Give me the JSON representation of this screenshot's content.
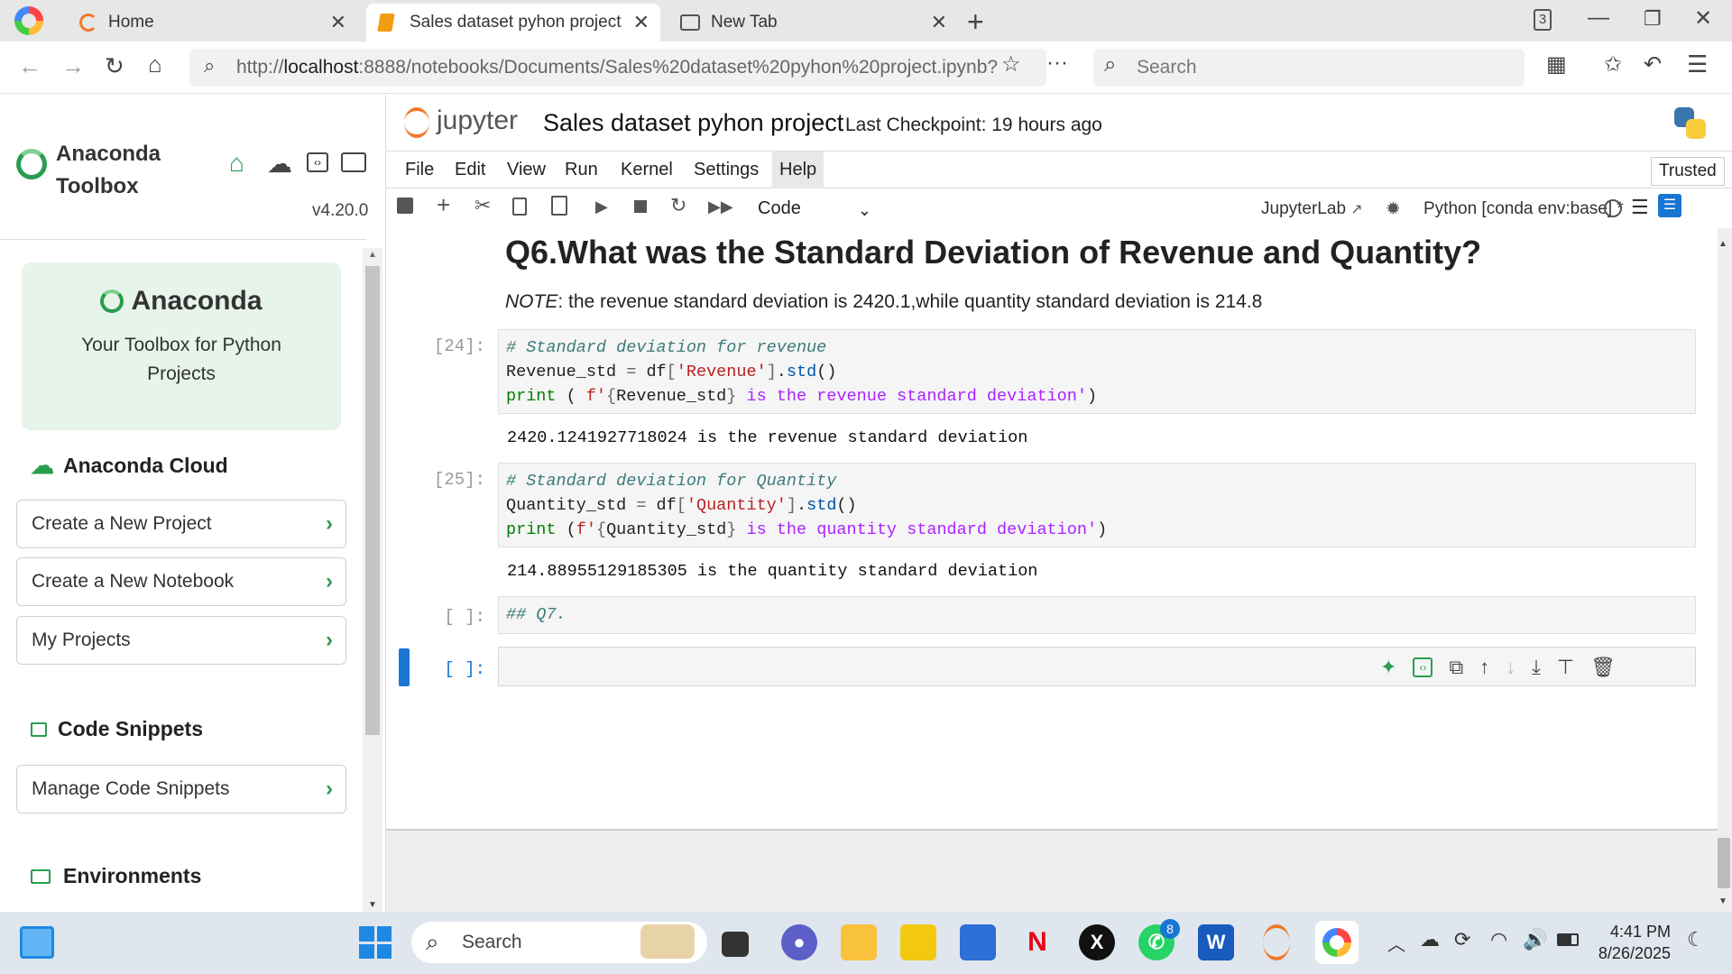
{
  "browser": {
    "tabs": [
      {
        "title": "Home"
      },
      {
        "title": "Sales dataset pyhon project"
      },
      {
        "title": "New Tab"
      }
    ],
    "tab_count": "3",
    "url_prefix": "http://",
    "url_host": "localhost",
    "url_rest": ":8888/notebooks/Documents/Sales%20dataset%20pyhon%20project.ipynb?",
    "search_placeholder": "Search"
  },
  "sidebar": {
    "title_line1": "Anaconda",
    "title_line2": "Toolbox",
    "version": "v4.20.0",
    "hero_brand": "Anaconda",
    "hero_text": "Your Toolbox for Python Projects",
    "cloud_heading": "Anaconda Cloud",
    "cloud_items": [
      {
        "label": "Create a New Project"
      },
      {
        "label": "Create a New Notebook"
      },
      {
        "label": "My Projects"
      }
    ],
    "snippets_heading": "Code Snippets",
    "snippets_item": "Manage Code Snippets",
    "env_heading": "Environments"
  },
  "jupyter": {
    "logo_text": "jupyter",
    "notebook_title": "Sales dataset pyhon project",
    "checkpoint": "Last Checkpoint: 19 hours ago",
    "trusted": "Trusted",
    "menu": [
      "File",
      "Edit",
      "View",
      "Run",
      "Kernel",
      "Settings",
      "Help"
    ],
    "cell_type": "Code",
    "jupyterlab_link": "JupyterLab",
    "kernel": "Python [conda env:base] *"
  },
  "notebook": {
    "heading": "Q6.What was the Standard Deviation of Revenue and Quantity?",
    "note_label": "NOTE",
    "note_text": ": the revenue standard deviation is 2420.1,while quantity standard deviation is 214.8",
    "cells": [
      {
        "prompt": "[24]:",
        "output": "2420.1241927718024 is the revenue standard deviation"
      },
      {
        "prompt": "[25]:",
        "output": "214.88955129185305 is the quantity standard deviation"
      },
      {
        "prompt": "[ ]:",
        "source": "## Q7."
      },
      {
        "prompt": "[ ]:"
      }
    ]
  },
  "taskbar": {
    "search_placeholder": "Search",
    "whatsapp_badge": "8",
    "time": "4:41 PM",
    "date": "8/26/2025"
  },
  "colors": {
    "anaconda_green": "#2a9d4e",
    "jupyter_orange": "#f37726",
    "active_cell_bar": "#1976d2"
  }
}
